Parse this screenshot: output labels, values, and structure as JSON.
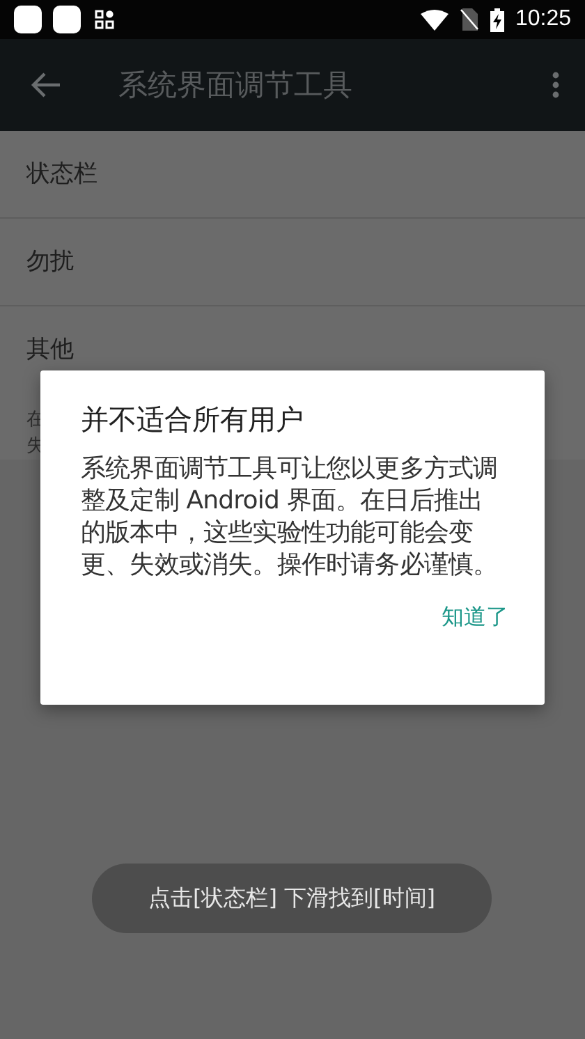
{
  "status_bar": {
    "time": "10:25"
  },
  "toolbar": {
    "title": "系统界面调节工具"
  },
  "list": {
    "items": [
      {
        "label": "状态栏"
      },
      {
        "label": "勿扰"
      },
      {
        "label": "其他"
      }
    ],
    "footer_lines": [
      "在",
      "失"
    ]
  },
  "dialog": {
    "title": "并不适合所有用户",
    "message": "系统界面调节工具可让您以更多方式调整及定制 Android 界面。在日后推出的版本中，这些实验性功能可能会变更、失效或消失。操作时请务必谨慎。",
    "button": "知道了"
  },
  "toast": {
    "text": "点击[状态栏] 下滑找到[时间]"
  }
}
